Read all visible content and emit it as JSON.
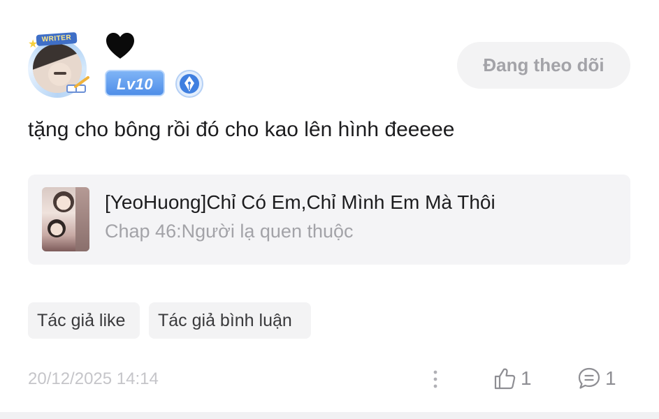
{
  "header": {
    "avatar_badge_text": "WRITER",
    "heart_icon": "black-heart-icon",
    "level_badge": "Lv10",
    "pen_badge_icon": "fountain-pen-icon",
    "follow_button_label": "Đang theo dõi"
  },
  "comment": {
    "text": "tặng cho bông rồi đó cho kao lên hình đeeeee"
  },
  "story": {
    "title": "[YeoHuong]Chỉ Có Em,Chỉ Mình Em Mà Thôi",
    "chapter": "Chap 46:Người lạ quen thuộc"
  },
  "tags": [
    {
      "label": "Tác giả like"
    },
    {
      "label": "Tác giả bình luận"
    }
  ],
  "footer": {
    "timestamp": "20/12/2025 14:14",
    "more_icon": "vertical-dots-icon",
    "like_icon": "thumbs-up-icon",
    "like_count": "1",
    "reply_icon": "chat-bubble-icon",
    "reply_count": "1"
  },
  "colors": {
    "level_badge_blue": "#4f8ee8",
    "muted_gray": "#a3a3a8",
    "card_background": "#f4f4f6"
  }
}
